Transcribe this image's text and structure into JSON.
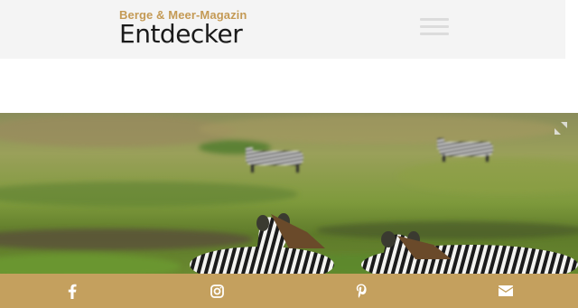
{
  "header": {
    "logo_subtitle": "Berge & Meer-Magazin",
    "logo_title": "Entdecker",
    "menu_icon": "hamburger-menu-icon"
  },
  "hero": {
    "subject": "zebras-on-savanna",
    "expand_icon": "expand-icon"
  },
  "share_bar": {
    "items": [
      {
        "icon": "facebook-icon"
      },
      {
        "icon": "instagram-icon"
      },
      {
        "icon": "pinterest-icon"
      },
      {
        "icon": "email-icon"
      }
    ]
  },
  "colors": {
    "brand_gold": "#c4a05e",
    "logo_gold": "#c49a55",
    "header_bg": "#f4f4f4",
    "logo_text": "#1a1a1a"
  }
}
